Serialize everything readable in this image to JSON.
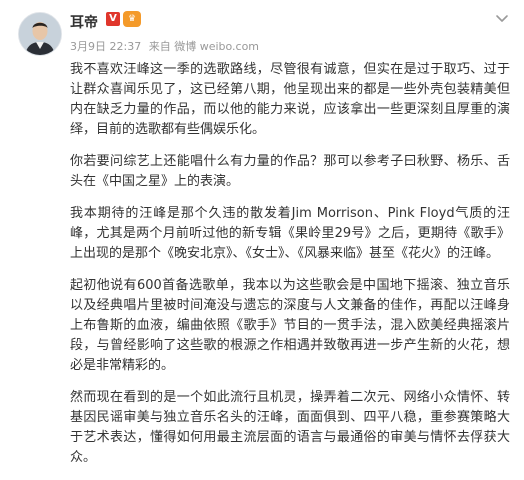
{
  "post": {
    "author": {
      "name": "耳帝",
      "verified_badge": "V",
      "member_icon": "♛"
    },
    "meta": {
      "date": "3月9日 22:37",
      "source": "来自 微博 weibo.com"
    },
    "paragraphs": [
      "我不喜欢汪峰这一季的选歌路线，尽管很有诚意，但实在是过于取巧、过于让群众喜闻乐见了，这已经第八期，他呈现出来的都是一些外壳包装精美但内在缺乏力量的作品，而以他的能力来说，应该拿出一些更深刻且厚重的演绎，目前的选歌都有些偶娱乐化。",
      "你若要问综艺上还能唱什么有力量的作品？那可以参考子曰秋野、杨乐、舌头在《中国之星》上的表演。",
      "我本期待的汪峰是那个久违的散发着Jim Morrison、Pink Floyd气质的汪峰，尤其是两个月前听过他的新专辑《果岭里29号》之后，更期待《歌手》上出现的是那个《晚安北京》、《女士》、《风暴来临》甚至《花火》的汪峰。",
      "起初他说有600首备选歌单，我本以为这些歌会是中国地下摇滚、独立音乐以及经典唱片里被时间淹没与遗忘的深度与人文兼备的佳作，再配以汪峰身上布鲁斯的血液，编曲依照《歌手》节目的一贯手法，混入欧美经典摇滚片段，与曾经影响了这些歌的根源之作相遇并致敬再进一步产生新的火花，想必是非常精彩的。",
      "然而现在看到的是一个如此流行且机灵，操弄着二次元、网络小众情怀、转基因民谣审美与独立音乐名头的汪峰，面面俱到、四平八稳，重参赛策略大于艺术表达，懂得如何用最主流层面的语言与最通俗的审美与情怀去俘获大众。"
    ],
    "icons": {
      "avatar": "avatar-photo",
      "menu": "chevron-down-icon"
    }
  }
}
